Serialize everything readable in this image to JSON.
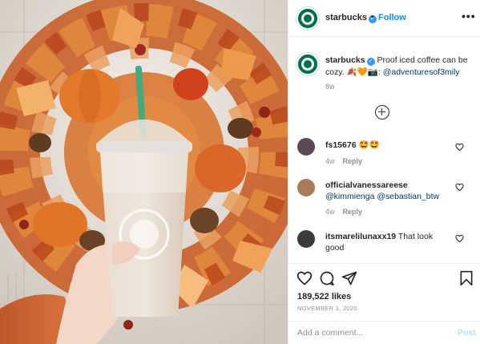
{
  "post": {
    "image_alt": "Hand holding a Starbucks iced coffee in front of an autumn leaf wreath"
  },
  "header": {
    "username": "starbucks",
    "verified_mark": "✓",
    "separator": "•",
    "follow_label": "Follow",
    "more_label": "•••"
  },
  "caption": {
    "username": "starbucks",
    "text": "Proof iced coffee can be cozy.",
    "emoji": "🍂🧡📷:",
    "mention": "@adventuresof3mily",
    "time": "8w"
  },
  "comments": [
    {
      "username": "fs15676",
      "text": "🤩🤩",
      "mentions": "",
      "time": "4w",
      "reply_label": "Reply"
    },
    {
      "username": "officialvanessareese",
      "text": "",
      "mentions": "@kimmienga @sebastian_btw",
      "time": "4w",
      "reply_label": "Reply"
    },
    {
      "username": "itsmarelilunaxx19",
      "text": "That look good",
      "mentions": "",
      "time": "",
      "reply_label": ""
    }
  ],
  "stats": {
    "likes": "189,522 likes",
    "date": "NOVEMBER 1, 2020"
  },
  "add_comment": {
    "placeholder": "Add a comment...",
    "post_label": "Post"
  },
  "icons": {
    "like": "heart-icon",
    "comment": "comment-icon",
    "share": "share-icon",
    "save": "bookmark-icon",
    "load_more": "plus-circle-icon"
  },
  "colors": {
    "link_blue": "#0095f6",
    "verified_blue": "#3897f0",
    "starbucks_green": "#00704a",
    "post_disabled": "#b2dffc"
  }
}
